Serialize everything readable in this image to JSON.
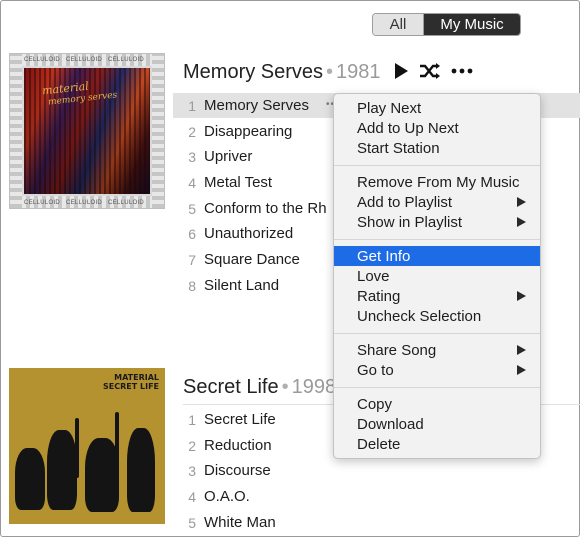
{
  "segmented": {
    "all_label": "All",
    "my_music_label": "My Music"
  },
  "albums": [
    {
      "title": "Memory Serves",
      "year": "1981",
      "art_text": {
        "label": "CELLULOID",
        "title": "material",
        "subtitle": "memory serves"
      },
      "tracks": [
        {
          "num": "1",
          "name": "Memory Serves"
        },
        {
          "num": "2",
          "name": "Disappearing"
        },
        {
          "num": "3",
          "name": "Upriver"
        },
        {
          "num": "4",
          "name": "Metal Test"
        },
        {
          "num": "5",
          "name": "Conform to the Rh"
        },
        {
          "num": "6",
          "name": "Unauthorized"
        },
        {
          "num": "7",
          "name": "Square Dance"
        },
        {
          "num": "8",
          "name": "Silent Land"
        }
      ]
    },
    {
      "title": "Secret Life",
      "year": "1998",
      "art_text": {
        "line1": "MATERIAL",
        "line2": "SECRET LIFE"
      },
      "tracks": [
        {
          "num": "1",
          "name": "Secret Life"
        },
        {
          "num": "2",
          "name": "Reduction"
        },
        {
          "num": "3",
          "name": "Discourse"
        },
        {
          "num": "4",
          "name": "O.A.O."
        },
        {
          "num": "5",
          "name": "White Man"
        }
      ]
    }
  ],
  "context_menu": {
    "items": [
      {
        "label": "Play Next"
      },
      {
        "label": "Add to Up Next"
      },
      {
        "label": "Start Station"
      },
      {
        "label": "Remove From My Music"
      },
      {
        "label": "Add to Playlist",
        "submenu": true
      },
      {
        "label": "Show in Playlist",
        "submenu": true
      },
      {
        "label": "Get Info",
        "highlighted": true
      },
      {
        "label": "Love"
      },
      {
        "label": "Rating",
        "submenu": true
      },
      {
        "label": "Uncheck Selection"
      },
      {
        "label": "Share Song",
        "submenu": true
      },
      {
        "label": "Go to",
        "submenu": true
      },
      {
        "label": "Copy"
      },
      {
        "label": "Download"
      },
      {
        "label": "Delete"
      }
    ]
  },
  "colors": {
    "highlight": "#1e6ce5",
    "selected_row": "#e2e2e2",
    "segment_active": "#2d2d2d"
  },
  "icons": [
    "play-icon",
    "shuffle-icon",
    "more-icon",
    "submenu-arrow-icon"
  ]
}
